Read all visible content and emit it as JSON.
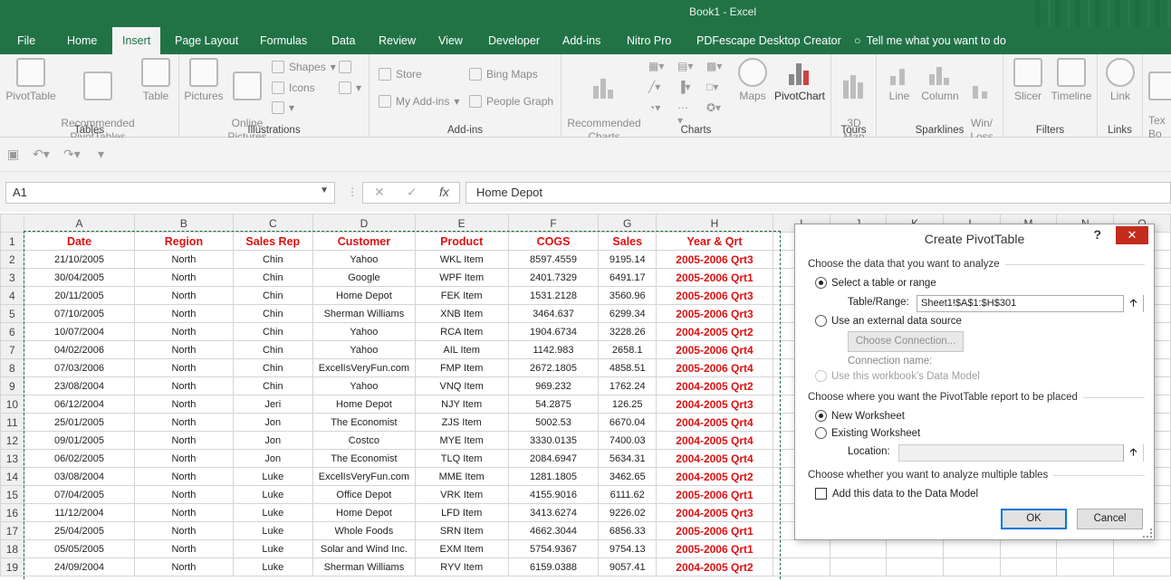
{
  "window": {
    "title": "Book1  -  Excel"
  },
  "tabs": [
    "File",
    "Home",
    "Insert",
    "Page Layout",
    "Formulas",
    "Data",
    "Review",
    "View",
    "Developer",
    "Add-ins",
    "Nitro Pro",
    "PDFescape Desktop Creator"
  ],
  "active_tab": "Insert",
  "tell_me": "Tell me what you want to do",
  "ribbon": {
    "tables": {
      "label": "Tables",
      "pivottable": "PivotTable",
      "recommended": "Recommended\nPivotTables",
      "table": "Table"
    },
    "illustrations": {
      "label": "Illustrations",
      "pictures": "Pictures",
      "online_pictures": "Online\nPictures",
      "shapes": "Shapes",
      "icons": "Icons"
    },
    "addins": {
      "label": "Add-ins",
      "store": "Store",
      "my_addins": "My Add-ins",
      "bing_maps": "Bing Maps",
      "people_graph": "People Graph"
    },
    "charts": {
      "label": "Charts",
      "recommended": "Recommended\nCharts",
      "maps": "Maps",
      "pivotchart": "PivotChart"
    },
    "tours": {
      "label": "Tours",
      "map3d": "3D\nMap"
    },
    "sparklines": {
      "label": "Sparklines",
      "line": "Line",
      "column": "Column",
      "winloss": "Win/\nLoss"
    },
    "filters": {
      "label": "Filters",
      "slicer": "Slicer",
      "timeline": "Timeline"
    },
    "links": {
      "label": "Links",
      "link": "Link"
    },
    "text": {
      "label": "Tex\nBo"
    }
  },
  "namebox": "A1",
  "formula": "Home Depot",
  "columns": [
    "A",
    "B",
    "C",
    "D",
    "E",
    "F",
    "G",
    "H",
    "I",
    "J",
    "K",
    "L",
    "M",
    "N",
    "O"
  ],
  "headers": [
    "Date",
    "Region",
    "Sales Rep",
    "Customer",
    "Product",
    "COGS",
    "Sales",
    "Year & Qrt"
  ],
  "rows": [
    [
      "21/10/2005",
      "North",
      "Chin",
      "Yahoo",
      "WKL Item",
      "8597.4559",
      "9195.14",
      "2005-2006 Qrt3"
    ],
    [
      "30/04/2005",
      "North",
      "Chin",
      "Google",
      "WPF Item",
      "2401.7329",
      "6491.17",
      "2005-2006 Qrt1"
    ],
    [
      "20/11/2005",
      "North",
      "Chin",
      "Home Depot",
      "FEK Item",
      "1531.2128",
      "3560.96",
      "2005-2006 Qrt3"
    ],
    [
      "07/10/2005",
      "North",
      "Chin",
      "Sherman Williams",
      "XNB Item",
      "3464.637",
      "6299.34",
      "2005-2006 Qrt3"
    ],
    [
      "10/07/2004",
      "North",
      "Chin",
      "Yahoo",
      "RCA Item",
      "1904.6734",
      "3228.26",
      "2004-2005 Qrt2"
    ],
    [
      "04/02/2006",
      "North",
      "Chin",
      "Yahoo",
      "AIL Item",
      "1142.983",
      "2658.1",
      "2005-2006 Qrt4"
    ],
    [
      "07/03/2006",
      "North",
      "Chin",
      "ExcelIsVeryFun.com",
      "FMP Item",
      "2672.1805",
      "4858.51",
      "2005-2006 Qrt4"
    ],
    [
      "23/08/2004",
      "North",
      "Chin",
      "Yahoo",
      "VNQ Item",
      "969.232",
      "1762.24",
      "2004-2005 Qrt2"
    ],
    [
      "06/12/2004",
      "North",
      "Jeri",
      "Home Depot",
      "NJY Item",
      "54.2875",
      "126.25",
      "2004-2005 Qrt3"
    ],
    [
      "25/01/2005",
      "North",
      "Jon",
      "The Economist",
      "ZJS Item",
      "5002.53",
      "6670.04",
      "2004-2005 Qrt4"
    ],
    [
      "09/01/2005",
      "North",
      "Jon",
      "Costco",
      "MYE Item",
      "3330.0135",
      "7400.03",
      "2004-2005 Qrt4"
    ],
    [
      "06/02/2005",
      "North",
      "Jon",
      "The Economist",
      "TLQ Item",
      "2084.6947",
      "5634.31",
      "2004-2005 Qrt4"
    ],
    [
      "03/08/2004",
      "North",
      "Luke",
      "ExcelIsVeryFun.com",
      "MME Item",
      "1281.1805",
      "3462.65",
      "2004-2005 Qrt2"
    ],
    [
      "07/04/2005",
      "North",
      "Luke",
      "Office Depot",
      "VRK Item",
      "4155.9016",
      "6111.62",
      "2005-2006 Qrt1"
    ],
    [
      "11/12/2004",
      "North",
      "Luke",
      "Home Depot",
      "LFD Item",
      "3413.6274",
      "9226.02",
      "2004-2005 Qrt3"
    ],
    [
      "25/04/2005",
      "North",
      "Luke",
      "Whole Foods",
      "SRN Item",
      "4662.3044",
      "6856.33",
      "2005-2006 Qrt1"
    ],
    [
      "05/05/2005",
      "North",
      "Luke",
      "Solar and Wind Inc.",
      "EXM Item",
      "5754.9367",
      "9754.13",
      "2005-2006 Qrt1"
    ],
    [
      "24/09/2004",
      "North",
      "Luke",
      "Sherman Williams",
      "RYV Item",
      "6159.0388",
      "9057.41",
      "2004-2005 Qrt2"
    ]
  ],
  "dialog": {
    "title": "Create PivotTable",
    "help": "?",
    "close": "✕",
    "section1": "Choose the data that you want to analyze",
    "opt_select_range": "Select a table or range",
    "table_range_label": "Table/Range:",
    "table_range_value": "Sheet1!$A$1:$H$301",
    "opt_external": "Use an external data source",
    "choose_connection": "Choose Connection...",
    "connection_name": "Connection name:",
    "opt_data_model": "Use this workbook's Data Model",
    "section2": "Choose where you want the PivotTable report to be placed",
    "opt_new_ws": "New Worksheet",
    "opt_existing_ws": "Existing Worksheet",
    "location_label": "Location:",
    "location_value": "",
    "section3": "Choose whether you want to analyze multiple tables",
    "add_data_model": "Add this data to the Data Model",
    "ok": "OK",
    "cancel": "Cancel"
  },
  "colors": {
    "excel_green": "#217346",
    "header_red": "#e01010",
    "close_red": "#c42b1c"
  }
}
